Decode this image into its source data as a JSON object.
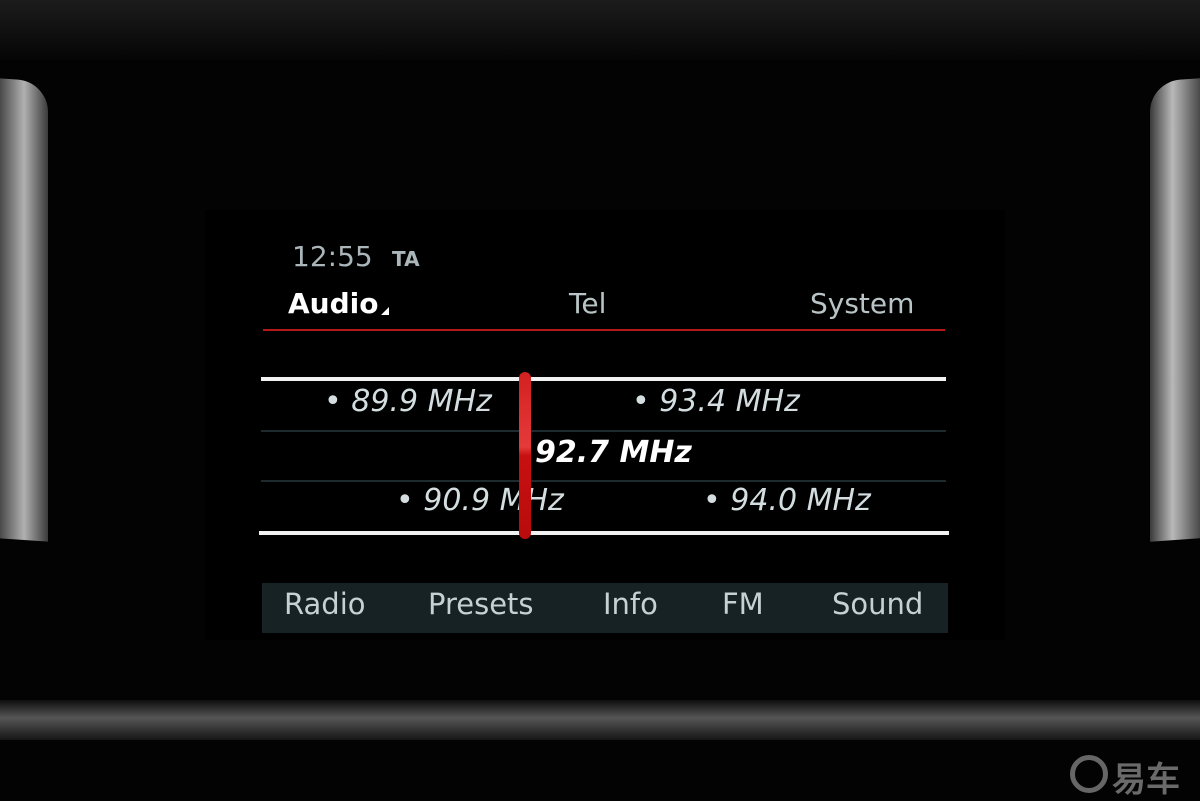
{
  "status": {
    "time": "12:55",
    "ta": "TA"
  },
  "tabs": [
    {
      "label": "Audio",
      "active": true
    },
    {
      "label": "Tel"
    },
    {
      "label": "System"
    }
  ],
  "tuner": {
    "current": "92.7 MHz",
    "stations": [
      "89.9 MHz",
      "93.4 MHz",
      "90.9 MHz",
      "94.0 MHz"
    ],
    "accent_color": "#d42020"
  },
  "softkeys": [
    "Radio",
    "Presets",
    "Info",
    "FM",
    "Sound"
  ],
  "watermark": "易车"
}
